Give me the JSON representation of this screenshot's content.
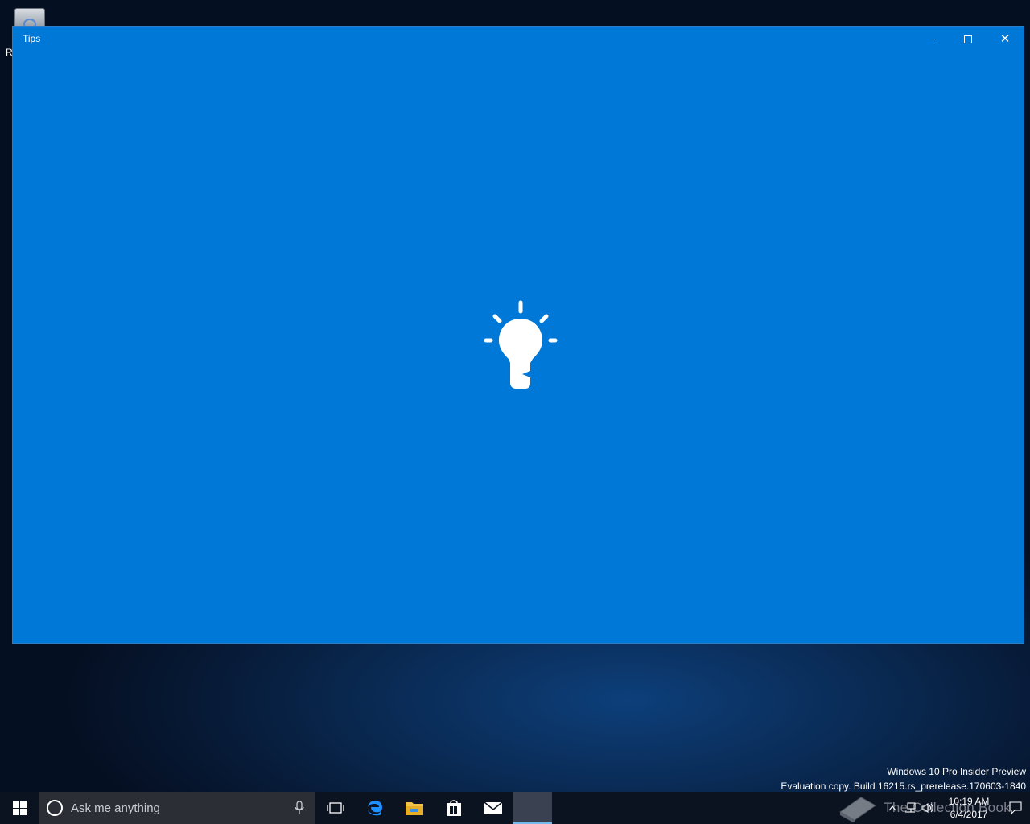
{
  "desktop": {
    "recycle_bin_label": "R",
    "watermark_line1": "Windows 10 Pro Insider Preview",
    "watermark_line2": "Evaluation copy. Build 16215.rs_prerelease.170603-1840",
    "overlay_logo_text": "The Collection Book"
  },
  "window": {
    "title": "Tips",
    "accent_color": "#0078d7",
    "splash_icon": "lightbulb-icon"
  },
  "taskbar": {
    "search_placeholder": "Ask me anything",
    "pinned": [
      "task-view-icon",
      "edge-icon",
      "file-explorer-icon",
      "store-icon",
      "mail-icon",
      "tips-icon"
    ],
    "active_app": "Tips",
    "clock_time": "10:19 AM",
    "clock_date": "6/4/2017"
  }
}
